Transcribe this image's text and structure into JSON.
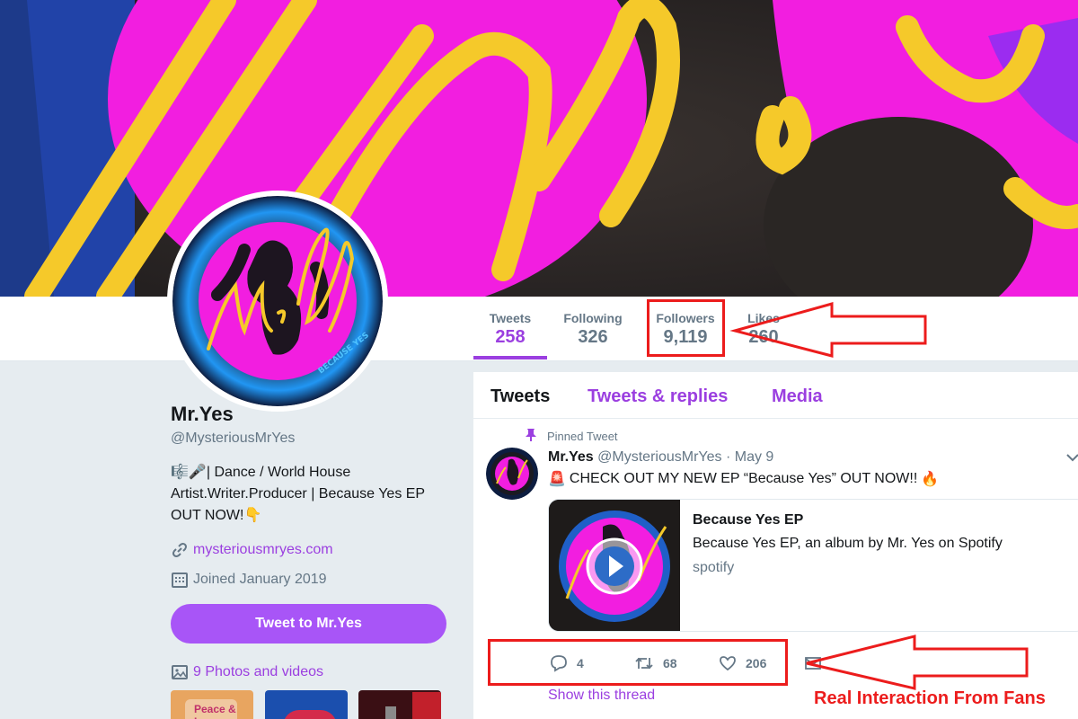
{
  "banner": {
    "art_text": "Mr. Y"
  },
  "stats": [
    {
      "label": "Tweets",
      "value": "258"
    },
    {
      "label": "Following",
      "value": "326"
    },
    {
      "label": "Followers",
      "value": "9,119"
    },
    {
      "label": "Likes",
      "value": "260"
    }
  ],
  "profile": {
    "name": "Mr.Yes",
    "handle": "@MysteriousMrYes",
    "bio_line1": "| Dance / World House",
    "bio_line2": "Artist.Writer.Producer | Because Yes EP",
    "bio_line3": "OUT NOW!",
    "bio_emoji": [
      "🎼",
      "🎤",
      "👇"
    ],
    "website": "mysteriousmryes.com",
    "joined": "Joined January 2019",
    "tweet_to_label": "Tweet to Mr.Yes",
    "photos_label": "9 Photos and videos",
    "photo_thumbs": [
      "Peace & Love",
      "",
      ""
    ]
  },
  "avatar": {
    "logo_text": "Mr. Yes",
    "sub_text": "BECAUSE YES"
  },
  "timeline": {
    "tabs": [
      "Tweets",
      "Tweets & replies",
      "Media"
    ],
    "pinned_label": "Pinned Tweet",
    "tweet": {
      "name": "Mr.Yes",
      "handle": "@MysteriousMrYes",
      "date": "· May 9",
      "text": "CHECK OUT MY NEW EP “Because Yes” OUT NOW!!",
      "text_emoji_start": "🚨",
      "text_emoji_end": "🔥",
      "card": {
        "title": "Because Yes EP",
        "description": "Because Yes EP, an album by Mr. Yes on Spotify",
        "domain": "spotify"
      },
      "replies": "4",
      "retweets": "68",
      "likes": "206",
      "show_thread": "Show this thread"
    }
  },
  "annotation": {
    "label": "Real Interaction From Fans"
  },
  "colors": {
    "accent": "#9b3fe0",
    "button": "#a855f7",
    "annotation": "#ec1c1c",
    "banner_pink": "#f21ee0",
    "banner_yellow": "#f5c92a"
  }
}
